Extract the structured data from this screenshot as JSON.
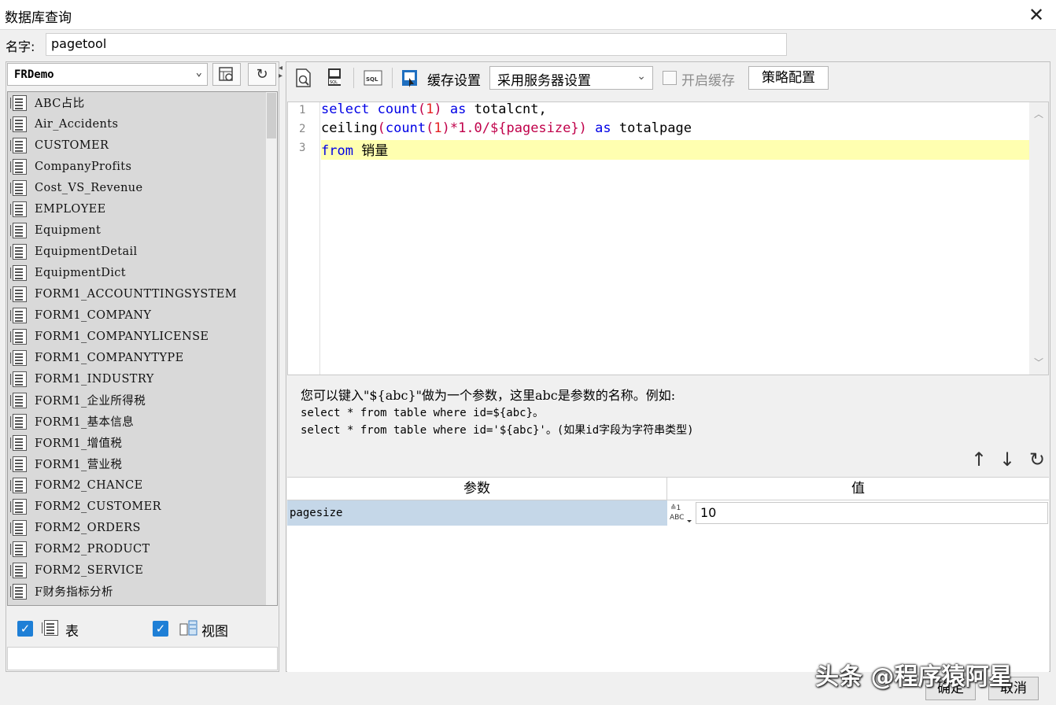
{
  "window": {
    "title": "数据库查询",
    "close_label": "✕"
  },
  "name_field": {
    "label": "名字:",
    "value": "pagetool"
  },
  "left": {
    "database": "FRDemo",
    "tables": [
      "ABC占比",
      "Air_Accidents",
      "CUSTOMER",
      "CompanyProfits",
      "Cost_VS_Revenue",
      "EMPLOYEE",
      "Equipment",
      "EquipmentDetail",
      "EquipmentDict",
      "FORM1_ACCOUNTTINGSYSTEM",
      "FORM1_COMPANY",
      "FORM1_COMPANYLICENSE",
      "FORM1_COMPANYTYPE",
      "FORM1_INDUSTRY",
      "FORM1_企业所得税",
      "FORM1_基本信息",
      "FORM1_增值税",
      "FORM1_营业税",
      "FORM2_CHANCE",
      "FORM2_CUSTOMER",
      "FORM2_ORDERS",
      "FORM2_PRODUCT",
      "FORM2_SERVICE",
      "F财务指标分析"
    ],
    "show_tables": {
      "label": "表",
      "checked": true
    },
    "show_views": {
      "label": "视图",
      "checked": true
    }
  },
  "toolbar": {
    "cache_label": "缓存设置",
    "cache_option": "采用服务器设置",
    "enable_cache_label": "开启缓存",
    "policy_button": "策略配置"
  },
  "editor": {
    "line_numbers": [
      "1",
      "2",
      "3"
    ],
    "line1": {
      "kw1": "select",
      "fn": "count",
      "p1": "(",
      "n1": "1",
      "p2": ")",
      "kw2": "as",
      "rest": "totalcnt,"
    },
    "line2": {
      "a": "ceiling",
      "p1": "(",
      "fn": "count",
      "p2": "(",
      "n1": "1",
      "p3": ")",
      "b": "*1.0/${pagesize}",
      "p4": ")",
      "kw": "as",
      "rest": "totalpage"
    },
    "line3": {
      "kw": "from",
      "rest": "销量"
    }
  },
  "hint": {
    "line1": "您可以键入\"${abc}\"做为一个参数，这里abc是参数的名称。例如:",
    "line2": "select * from table where id=${abc}。",
    "line3": "select * from table where id='${abc}'。(如果id字段为字符串类型)"
  },
  "params": {
    "header_param": "参数",
    "header_value": "值",
    "rows": [
      {
        "name": "pagesize",
        "type_icon": "ABC",
        "value": "10"
      }
    ]
  },
  "footer": {
    "ok": "确定",
    "cancel": "取消"
  },
  "watermark": "头条 @程序猿阿星"
}
